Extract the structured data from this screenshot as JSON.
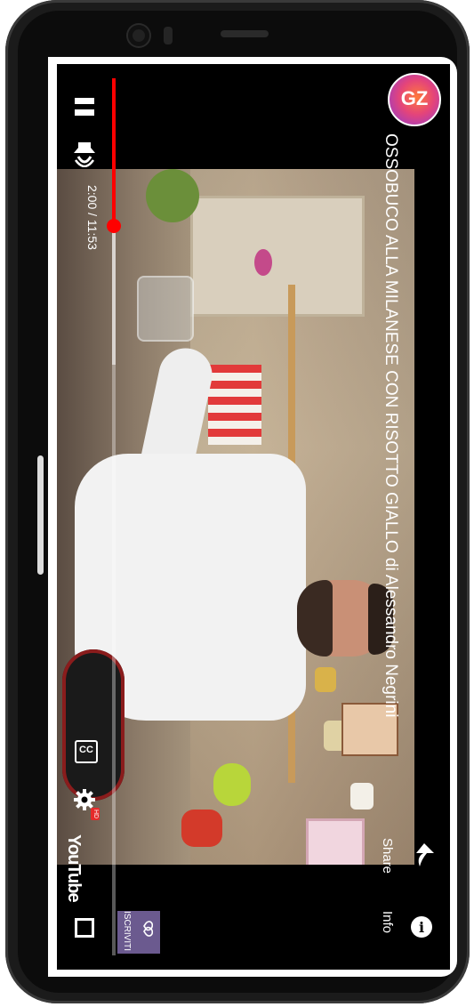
{
  "video": {
    "title": "OSSOBUCO ALLA MILANESE CON RISOTTO GIALLO di Alessandro Negrini",
    "channel_logo_text": "GZ"
  },
  "player": {
    "current_time": "2:00",
    "duration": "11:53",
    "time_readout": "2:00 / 11:53",
    "progress_fraction": 0.168,
    "buffered_fraction": 0.33
  },
  "actions": {
    "share_label": "Share",
    "info_label": "Info",
    "info_glyph": "i"
  },
  "controls": {
    "cc_label": "CC",
    "hd_badge": "HD",
    "brand": "YouTube",
    "subscribe_label": "ISCRIVITI"
  },
  "icons": {
    "pause": "pause-icon",
    "volume": "volume-icon",
    "share": "share-arrow-icon",
    "info": "info-icon",
    "captions": "cc-icon",
    "settings": "gear-icon",
    "fullscreen": "fullscreen-icon",
    "subscribe": "heart-icon"
  },
  "colors": {
    "progress": "#ff0000",
    "background": "#000000"
  }
}
